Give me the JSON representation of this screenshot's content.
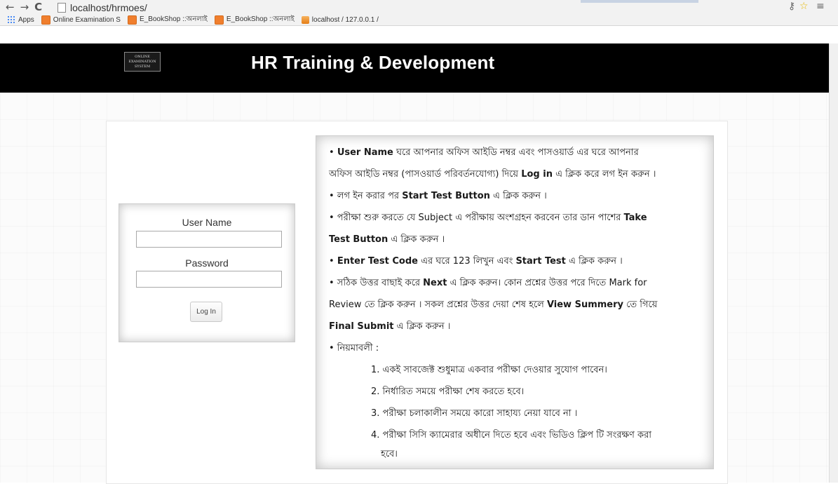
{
  "browser": {
    "url": "localhost/hrmoes/",
    "bookmarks": [
      {
        "label": "Apps",
        "icon": "apps-icon"
      },
      {
        "label": "Online Examination S",
        "icon": "bookmark-icon"
      },
      {
        "label": "E_BookShop ::অনলাই",
        "icon": "bookmark-icon"
      },
      {
        "label": "E_BookShop ::অনলাই",
        "icon": "bookmark-icon"
      },
      {
        "label": "localhost / 127.0.0.1 /",
        "icon": "phpmyadmin-icon"
      }
    ]
  },
  "header": {
    "logo_text": "ONLINE EXAMINATION SYSTEM",
    "title": "HR Training & Development"
  },
  "login": {
    "username_label": "User Name",
    "password_label": "Password",
    "button_label": "Log In"
  },
  "instructions": {
    "l1a": "• ",
    "l1b": "User Name",
    "l1c": " ঘরে আপনার অফিস আইডি নম্বর এবং পাসওয়ার্ড এর ঘরে আপনার",
    "l2a": "অফিস আইডি নম্বর (পাসওয়ার্ড পরিবর্তনযোগ্য) দিয়ে ",
    "l2b": "Log in",
    "l2c": " এ ক্লিক করে লগ ইন করুন ।",
    "l3a": "• লগ ইন করার পর ",
    "l3b": "Start Test Button",
    "l3c": " এ ক্লিক করুন ।",
    "l4a": "• পরীক্ষা শুরু করতে যে Subject এ পরীক্ষায় অংশগ্রহন করবেন তার ডান পাশের ",
    "l4b": "Take",
    "l5a": "Test Button",
    "l5b": " এ ক্লিক করুন ।",
    "l6a": "• ",
    "l6b": "Enter Test Code",
    "l6c": " এর ঘরে 123 লিখুন এবং ",
    "l6d": "Start Test",
    "l6e": " এ ক্লিক করুন ।",
    "l7a": "• সঠিক উত্তর বাছাই করে ",
    "l7b": "Next",
    "l7c": " এ ক্লিক করুন। কোন প্রশ্নের উত্তর পরে দিতে Mark for",
    "l8a": "Review তে ক্লিক করুন । সকল প্রশ্নের উত্তর দেয়া শেষ হলে ",
    "l8b": "View Summery",
    "l8c": " তে গিয়ে",
    "l9a": "Final Submit",
    "l9b": " এ ক্লিক করুন ।",
    "l10": "• নিয়মাবলী :",
    "r1": "1. একই সাবজেক্ট শুধুমাত্র একবার পরীক্ষা দেওয়ার সুযোগ পাবেন।",
    "r2": "2. নির্ধারিত সময়ে পরীক্ষা শেষ করতে হবে।",
    "r3": "3. পরীক্ষা চলাকালীন সময়ে কারো সাহায্য নেয়া যাবে না ।",
    "r4": "4. পরীক্ষা সিসি ক্যামেরার অধীনে দিতে হবে এবং ভিডিও ক্লিপ টি সংরক্ষণ করা",
    "r4b": "হবে।"
  }
}
